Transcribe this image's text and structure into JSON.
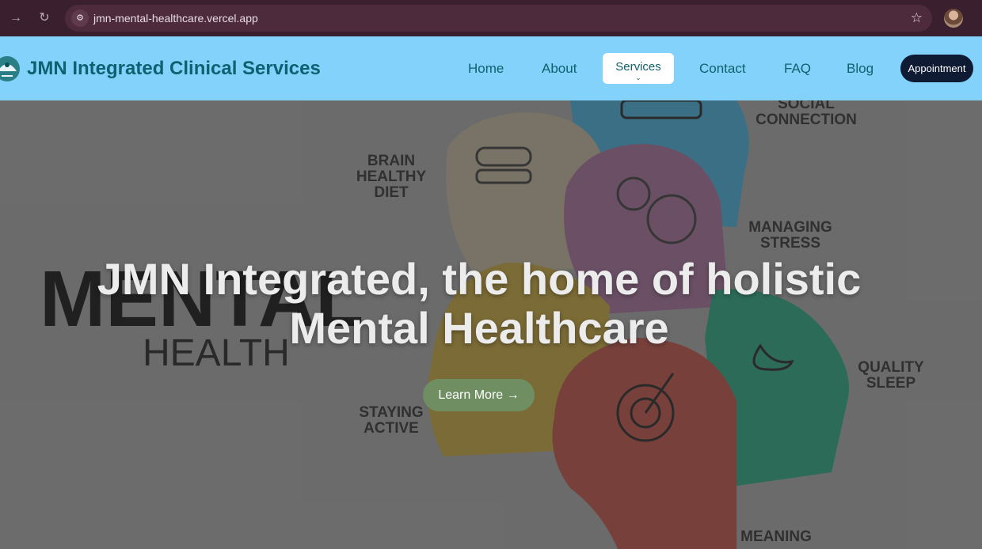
{
  "browser": {
    "url": "jmn-mental-healthcare.vercel.app",
    "icons": [
      "forward-icon",
      "reload-icon",
      "site-info-icon",
      "bookmark-star-icon",
      "profile-avatar"
    ]
  },
  "header": {
    "brand": "JMN Integrated Clinical Services",
    "nav": {
      "home": "Home",
      "about": "About",
      "services": "Services",
      "contact": "Contact",
      "faq": "FAQ",
      "blog": "Blog"
    },
    "appointment": "Appointment",
    "background_color": "#82d2fb",
    "brand_color": "#0e6170"
  },
  "hero": {
    "title_line1": "JMN Integrated, the home of holistic",
    "title_line2": "Mental Healthcare",
    "cta": "Learn More →",
    "image_labels": {
      "word_big": "MENTAL",
      "word_small": "HEALTH",
      "diet": "BRAIN HEALTHY DIET",
      "social": "SOCIAL CONNECTION",
      "stress": "MANAGING STRESS",
      "sleep": "QUALITY SLEEP",
      "active": "STAYING ACTIVE",
      "meaning": "MEANING"
    }
  }
}
